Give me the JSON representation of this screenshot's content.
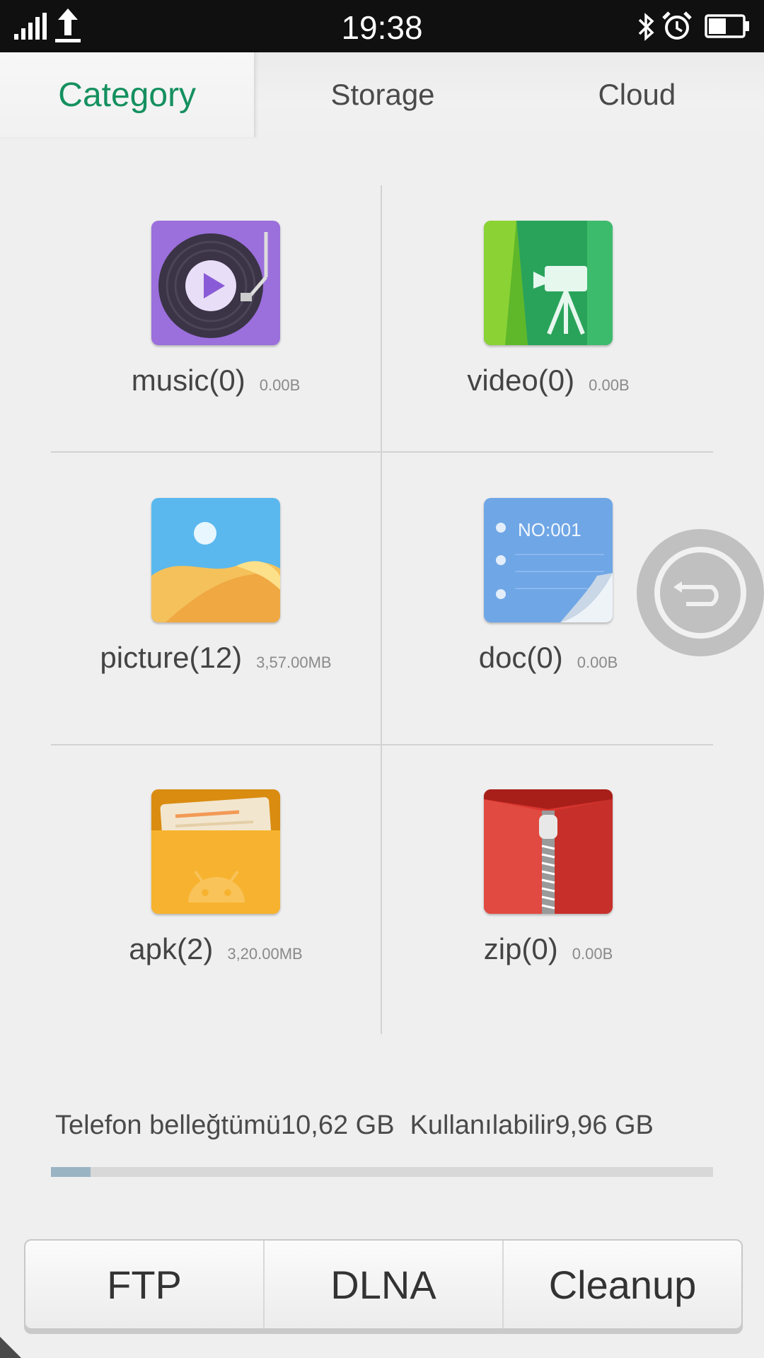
{
  "status_bar": {
    "time": "19:38",
    "icons": [
      "signal-icon",
      "upload-icon",
      "bluetooth-icon",
      "alarm-icon",
      "battery-icon"
    ]
  },
  "tabs": [
    {
      "label": "Category",
      "active": true
    },
    {
      "label": "Storage",
      "active": false
    },
    {
      "label": "Cloud",
      "active": false
    }
  ],
  "categories": {
    "music": {
      "label": "music(0)",
      "size": "0.00B",
      "icon": "music-icon"
    },
    "video": {
      "label": "video(0)",
      "size": "0.00B",
      "icon": "video-icon"
    },
    "picture": {
      "label": "picture(12)",
      "size": "3,57.00MB",
      "icon": "picture-icon"
    },
    "doc": {
      "label": "doc(0)",
      "size": "0.00B",
      "icon": "doc-icon",
      "icon_text": "NO:001"
    },
    "apk": {
      "label": "apk(2)",
      "size": "3,20.00MB",
      "icon": "apk-icon"
    },
    "zip": {
      "label": "zip(0)",
      "size": "0.00B",
      "icon": "zip-icon"
    }
  },
  "storage": {
    "total_text": "Telefon belleğtümü10,62 GB",
    "available_text": "Kullanılabilir9,96 GB",
    "used_fraction": 0.06
  },
  "bottom_buttons": {
    "ftp": "FTP",
    "dlna": "DLNA",
    "cleanup": "Cleanup"
  },
  "colors": {
    "accent": "#14905f",
    "statusbar": "#101010",
    "background": "#efefef"
  }
}
